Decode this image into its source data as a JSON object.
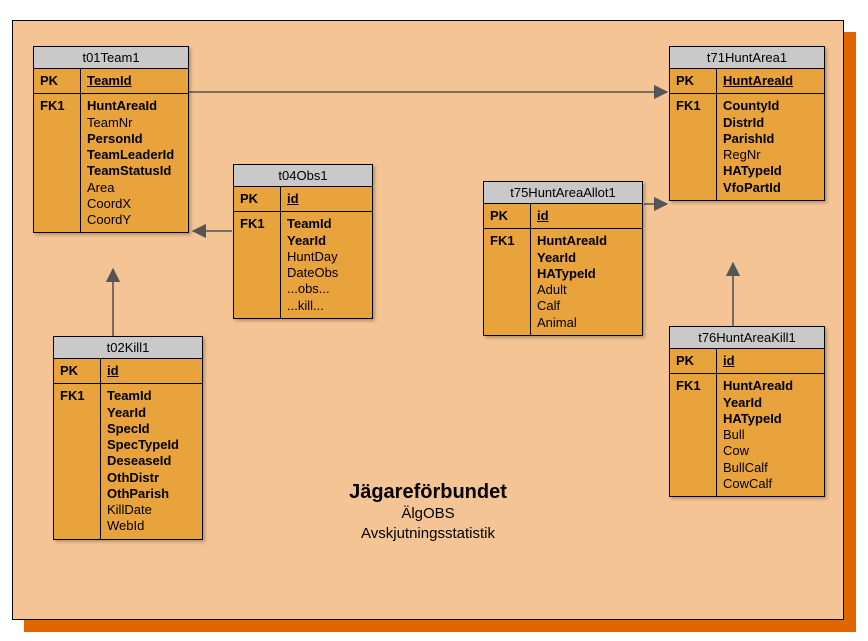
{
  "caption": {
    "title": "Jägareförbundet",
    "sub1": "ÄlgOBS",
    "sub2": "Avskjutningsstatistik"
  },
  "key": {
    "pk": "PK",
    "fk1": "FK1"
  },
  "t01": {
    "name": "t01Team1",
    "pk": "TeamId",
    "f1": "HuntAreaId",
    "f2": "TeamNr",
    "f3": "PersonId",
    "f4": "TeamLeaderId",
    "f5": "TeamStatusId",
    "f6": "Area",
    "f7": "CoordX",
    "f8": "CoordY"
  },
  "t02": {
    "name": "t02Kill1",
    "pk": "id",
    "f1": "TeamId",
    "f2": "YearId",
    "f3": "SpecId",
    "f4": "SpecTypeId",
    "f5": "DeseaseId",
    "f6": "OthDistr",
    "f7": "OthParish",
    "f8": "KillDate",
    "f9": "WebId"
  },
  "t04": {
    "name": "t04Obs1",
    "pk": "id",
    "f1": "TeamId",
    "f2": "YearId",
    "f3": "HuntDay",
    "f4": "DateObs",
    "f5": "...obs...",
    "f6": "...kill..."
  },
  "t71": {
    "name": "t71HuntArea1",
    "pk": "HuntAreaId",
    "f1": "CountyId",
    "f2": "DistrId",
    "f3": "ParishId",
    "f4": "RegNr",
    "f5": "HATypeId",
    "f6": "VfoPartId"
  },
  "t75": {
    "name": "t75HuntAreaAllot1",
    "pk": "id",
    "f1": "HuntAreaId",
    "f2": "YearId",
    "f3": "HATypeId",
    "f4": "Adult",
    "f5": "Calf",
    "f6": "Animal"
  },
  "t76": {
    "name": "t76HuntAreaKill1",
    "pk": "id",
    "f1": "HuntAreaId",
    "f2": "YearId",
    "f3": "HATypeId",
    "f4": "Bull",
    "f5": "Cow",
    "f6": "BullCalf",
    "f7": "CowCalf"
  }
}
